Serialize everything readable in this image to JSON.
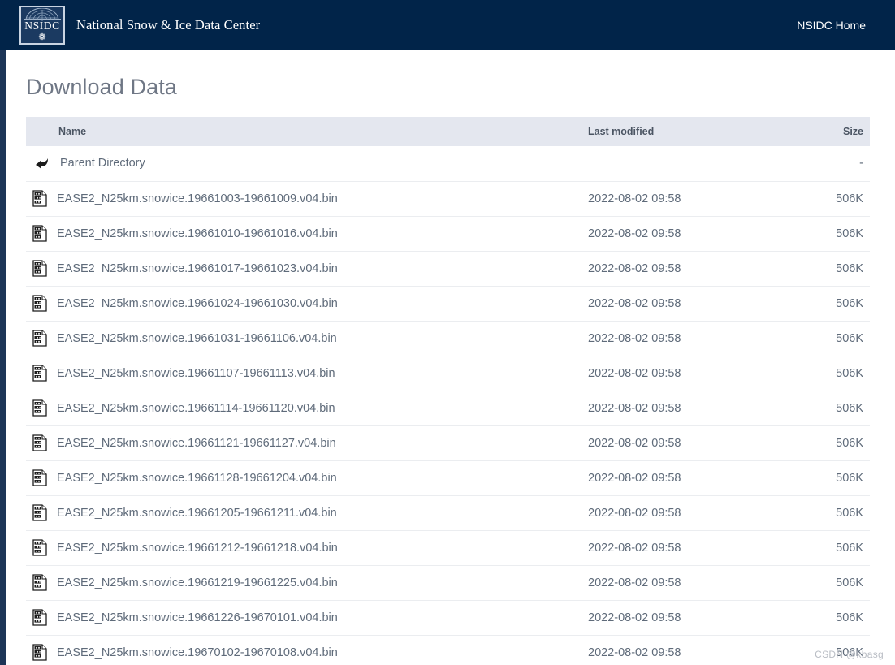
{
  "header": {
    "logo_word": "NSIDC",
    "logo_flake": "❁",
    "brand_title": "National Snow & Ice Data Center",
    "home_link": "NSIDC Home",
    "bg_color": "#012449"
  },
  "page": {
    "title": "Download Data",
    "title_color": "#6f7785"
  },
  "table": {
    "columns": {
      "name": "Name",
      "last_modified": "Last modified",
      "size": "Size"
    },
    "header_bg": "#e4e7ef",
    "parent": {
      "label": "Parent Directory",
      "last_modified": "",
      "size": "-",
      "icon": "back-arrow-icon"
    },
    "rows": [
      {
        "name": "EASE2_N25km.snowice.19661003-19661009.v04.bin",
        "last_modified": "2022-08-02 09:58",
        "size": "506K",
        "icon": "binary-file-icon"
      },
      {
        "name": "EASE2_N25km.snowice.19661010-19661016.v04.bin",
        "last_modified": "2022-08-02 09:58",
        "size": "506K",
        "icon": "binary-file-icon"
      },
      {
        "name": "EASE2_N25km.snowice.19661017-19661023.v04.bin",
        "last_modified": "2022-08-02 09:58",
        "size": "506K",
        "icon": "binary-file-icon"
      },
      {
        "name": "EASE2_N25km.snowice.19661024-19661030.v04.bin",
        "last_modified": "2022-08-02 09:58",
        "size": "506K",
        "icon": "binary-file-icon"
      },
      {
        "name": "EASE2_N25km.snowice.19661031-19661106.v04.bin",
        "last_modified": "2022-08-02 09:58",
        "size": "506K",
        "icon": "binary-file-icon"
      },
      {
        "name": "EASE2_N25km.snowice.19661107-19661113.v04.bin",
        "last_modified": "2022-08-02 09:58",
        "size": "506K",
        "icon": "binary-file-icon"
      },
      {
        "name": "EASE2_N25km.snowice.19661114-19661120.v04.bin",
        "last_modified": "2022-08-02 09:58",
        "size": "506K",
        "icon": "binary-file-icon"
      },
      {
        "name": "EASE2_N25km.snowice.19661121-19661127.v04.bin",
        "last_modified": "2022-08-02 09:58",
        "size": "506K",
        "icon": "binary-file-icon"
      },
      {
        "name": "EASE2_N25km.snowice.19661128-19661204.v04.bin",
        "last_modified": "2022-08-02 09:58",
        "size": "506K",
        "icon": "binary-file-icon"
      },
      {
        "name": "EASE2_N25km.snowice.19661205-19661211.v04.bin",
        "last_modified": "2022-08-02 09:58",
        "size": "506K",
        "icon": "binary-file-icon"
      },
      {
        "name": "EASE2_N25km.snowice.19661212-19661218.v04.bin",
        "last_modified": "2022-08-02 09:58",
        "size": "506K",
        "icon": "binary-file-icon"
      },
      {
        "name": "EASE2_N25km.snowice.19661219-19661225.v04.bin",
        "last_modified": "2022-08-02 09:58",
        "size": "506K",
        "icon": "binary-file-icon"
      },
      {
        "name": "EASE2_N25km.snowice.19661226-19670101.v04.bin",
        "last_modified": "2022-08-02 09:58",
        "size": "506K",
        "icon": "binary-file-icon"
      },
      {
        "name": "EASE2_N25km.snowice.19670102-19670108.v04.bin",
        "last_modified": "2022-08-02 09:58",
        "size": "506K",
        "icon": "binary-file-icon"
      }
    ]
  },
  "watermark": {
    "text": "CSDN @kbasg"
  }
}
